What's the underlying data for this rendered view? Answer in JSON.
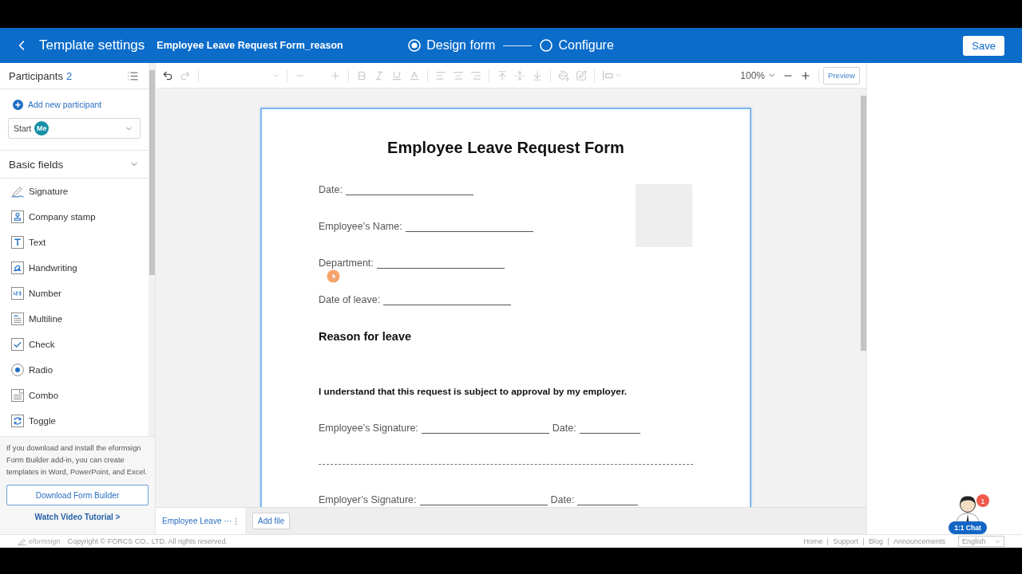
{
  "header": {
    "title": "Template settings",
    "document_name": "Employee Leave Request Form_reason",
    "steps": [
      {
        "label": "Design form",
        "selected": true
      },
      {
        "label": "Configure",
        "selected": false
      }
    ],
    "save_button": "Save"
  },
  "sidebar": {
    "participants_title": "Participants",
    "participants_count": "2",
    "add_participant": "Add new participant",
    "participant_select": {
      "label": "Start",
      "badge": "Me"
    },
    "section": {
      "title": "Basic fields",
      "expanded": true
    },
    "fields": [
      {
        "kind": "signature",
        "label": "Signature"
      },
      {
        "kind": "company_stamp",
        "label": "Company stamp"
      },
      {
        "kind": "text",
        "label": "Text"
      },
      {
        "kind": "handwriting",
        "label": "Handwriting"
      },
      {
        "kind": "number",
        "label": "Number"
      },
      {
        "kind": "multiline",
        "label": "Multiline"
      },
      {
        "kind": "check",
        "label": "Check"
      },
      {
        "kind": "radio",
        "label": "Radio"
      },
      {
        "kind": "combo",
        "label": "Combo"
      },
      {
        "kind": "toggle",
        "label": "Toggle"
      }
    ],
    "promo": {
      "text": "If you download and install the eformsign Form Builder add-in, you can create templates in Word, PowerPoint, and Excel.",
      "button": "Download Form Builder",
      "link": "Watch Video Tutorial >"
    }
  },
  "toolbar": {
    "tools": [
      {
        "kind": "undo",
        "disabled": false
      },
      {
        "kind": "redo",
        "disabled": true
      },
      {
        "kind": "separator"
      },
      {
        "kind": "font_size",
        "disabled": true
      },
      {
        "kind": "separator"
      },
      {
        "kind": "decrease",
        "disabled": true
      },
      {
        "kind": "increase",
        "disabled": true
      },
      {
        "kind": "separator"
      },
      {
        "kind": "bold",
        "disabled": true
      },
      {
        "kind": "italic",
        "disabled": true
      },
      {
        "kind": "underline",
        "disabled": true
      },
      {
        "kind": "font_color",
        "disabled": true
      },
      {
        "kind": "separator"
      },
      {
        "kind": "align_left",
        "disabled": true
      },
      {
        "kind": "align_center",
        "disabled": true
      },
      {
        "kind": "align_right",
        "disabled": true
      },
      {
        "kind": "separator"
      },
      {
        "kind": "align_top",
        "disabled": true
      },
      {
        "kind": "align_middle",
        "disabled": true
      },
      {
        "kind": "align_bottom",
        "disabled": true
      },
      {
        "kind": "separator"
      },
      {
        "kind": "fill_color",
        "disabled": true
      },
      {
        "kind": "border_color",
        "disabled": true
      },
      {
        "kind": "separator"
      },
      {
        "kind": "border_style",
        "disabled": true
      }
    ],
    "zoom": "100%",
    "zoom_tools": [
      {
        "kind": "zoom_out",
        "disabled": false
      },
      {
        "kind": "zoom_in",
        "disabled": false
      }
    ],
    "preview": "Preview"
  },
  "document": {
    "title": "Employee Leave Request Form",
    "lines": [
      {
        "kind": "field",
        "labels": [
          "Date:"
        ]
      },
      {
        "kind": "field",
        "labels": [
          "Employee’s Name:"
        ]
      },
      {
        "kind": "field",
        "labels": [
          "Department:"
        ]
      },
      {
        "kind": "field",
        "labels": [
          "Date of leave:"
        ]
      },
      {
        "kind": "heading",
        "text": "Reason for leave"
      },
      {
        "kind": "statement",
        "text": "I understand that this request is subject to approval by my employer."
      },
      {
        "kind": "field",
        "labels": [
          "Employee’s Signature:",
          "Date:"
        ]
      },
      {
        "kind": "separator"
      },
      {
        "kind": "field",
        "labels": [
          "Employer’s Signature:",
          "Date:"
        ]
      }
    ]
  },
  "file_tabs": [
    {
      "label": "Employee Leave ···",
      "selected": true
    }
  ],
  "add_file": "Add file",
  "footer": {
    "logo": "eformsign",
    "copyright": "Copyright © FORCS CO., LTD. All rights reserved.",
    "links": [
      "Home",
      "Support",
      "Blog",
      "Announcements"
    ],
    "language": "English"
  },
  "chat": {
    "label": "1:1 Chat",
    "badge": "1"
  }
}
